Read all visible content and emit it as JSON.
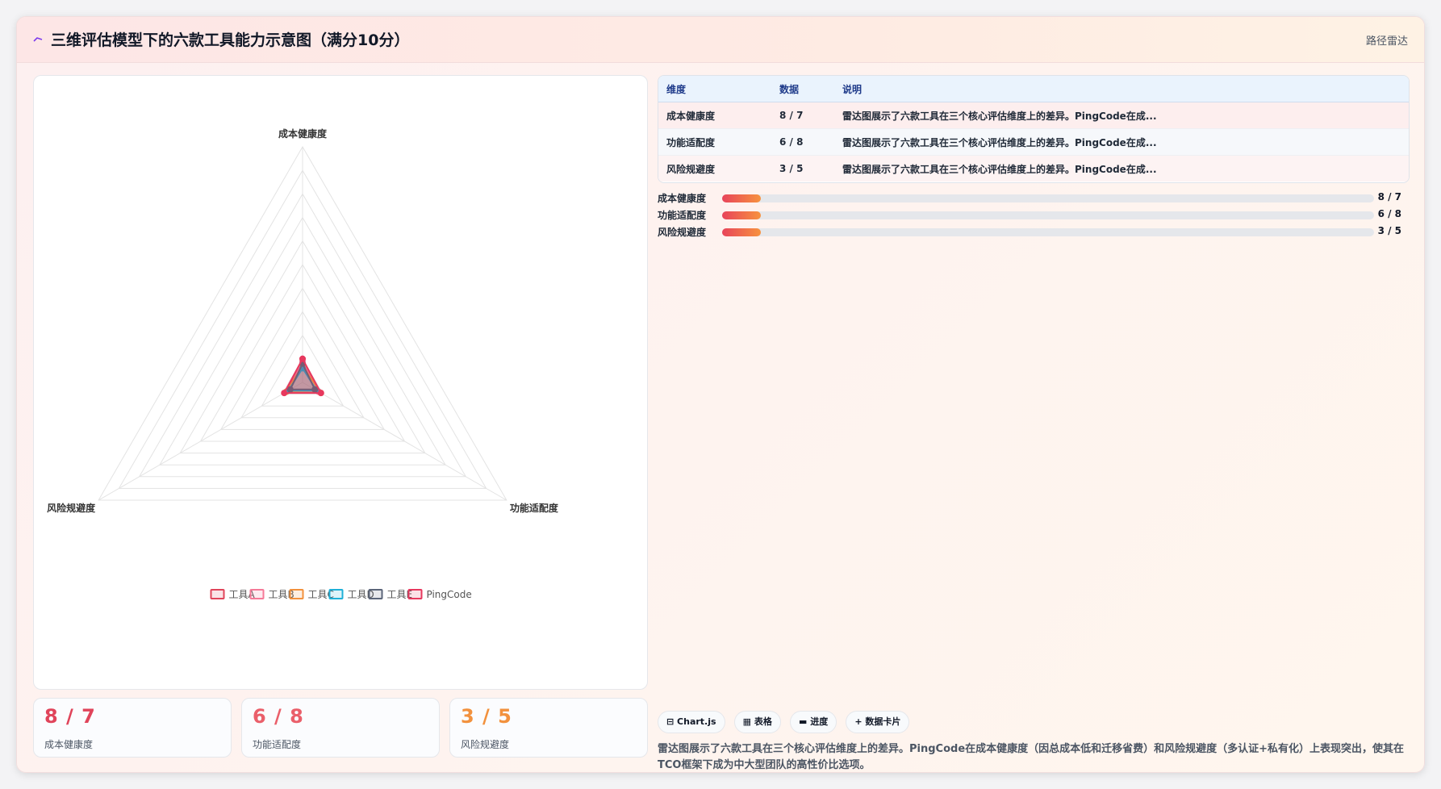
{
  "header": {
    "title": "三维评估模型下的六款工具能力示意图（满分10分）",
    "link": "路径雷达"
  },
  "chart_data": {
    "type": "radar",
    "axes": [
      "成本健康度",
      "功能适配度",
      "风险规避度"
    ],
    "r_max": 10,
    "series": [
      {
        "name": "工具A",
        "values": [
          1.0,
          0.8,
          0.8
        ],
        "color": "#e0445a"
      },
      {
        "name": "工具B",
        "values": [
          0.9,
          0.8,
          0.7
        ],
        "color": "#f57a98"
      },
      {
        "name": "工具C",
        "values": [
          0.7,
          0.9,
          0.8
        ],
        "color": "#f2913d"
      },
      {
        "name": "工具D",
        "values": [
          0.6,
          0.7,
          0.7
        ],
        "color": "#1fb0d8"
      },
      {
        "name": "工具E",
        "values": [
          0.8,
          0.6,
          0.6
        ],
        "color": "#5b6579"
      },
      {
        "name": "PingCode",
        "values": [
          1.0,
          0.9,
          0.9
        ],
        "color": "#e7385e"
      }
    ]
  },
  "stats": [
    {
      "value": "8 / 7",
      "label": "成本健康度",
      "color": "#e0445a"
    },
    {
      "value": "6 / 8",
      "label": "功能适配度",
      "color": "#ea5f6a"
    },
    {
      "value": "3 / 5",
      "label": "风险规避度",
      "color": "#f2913d"
    }
  ],
  "table": {
    "headers": [
      "维度",
      "数据",
      "说明"
    ],
    "rows": [
      [
        "成本健康度",
        "8 / 7",
        "雷达图展示了六款工具在三个核心评估维度上的差异。PingCode在成..."
      ],
      [
        "功能适配度",
        "6 / 8",
        "雷达图展示了六款工具在三个核心评估维度上的差异。PingCode在成..."
      ],
      [
        "风险规避度",
        "3 / 5",
        "雷达图展示了六款工具在三个核心评估维度上的差异。PingCode在成..."
      ]
    ]
  },
  "bars": [
    {
      "label": "成本健康度",
      "value": "8 / 7",
      "fraction": 0.06
    },
    {
      "label": "功能适配度",
      "value": "6 / 8",
      "fraction": 0.06
    },
    {
      "label": "风险规避度",
      "value": "3 / 5",
      "fraction": 0.06
    }
  ],
  "chips": [
    "⊟ Chart.js",
    "▦ 表格",
    "▬ 进度",
    "+ 数据卡片"
  ],
  "description": "雷达图展示了六款工具在三个核心评估维度上的差异。PingCode在成本健康度（因总成本低和迁移省费）和风险规避度（多认证+私有化）上表现突出，使其在TCO框架下成为中大型团队的高性价比选项。"
}
